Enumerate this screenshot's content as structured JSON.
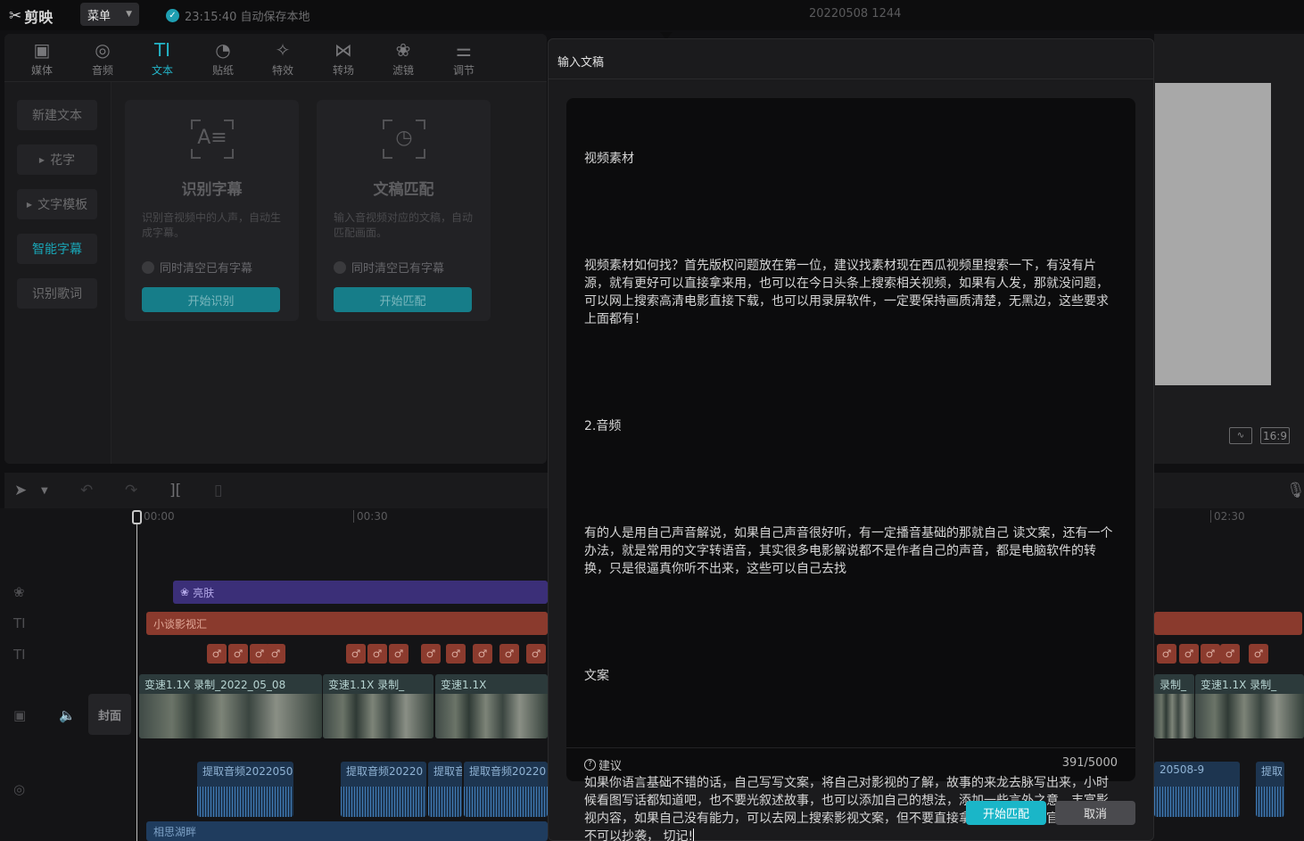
{
  "topbar": {
    "app_name": "剪映",
    "menu_label": "菜单",
    "autosave_text": "23:15:40 自动保存本地",
    "project_name": "20220508 1244"
  },
  "toolbar": {
    "tabs": [
      {
        "label": "媒体",
        "icon": "media-icon"
      },
      {
        "label": "音频",
        "icon": "audio-icon"
      },
      {
        "label": "文本",
        "icon": "text-icon",
        "active": true
      },
      {
        "label": "贴纸",
        "icon": "sticker-icon"
      },
      {
        "label": "特效",
        "icon": "effects-icon"
      },
      {
        "label": "转场",
        "icon": "transition-icon"
      },
      {
        "label": "滤镜",
        "icon": "filter-icon"
      },
      {
        "label": "调节",
        "icon": "adjust-icon"
      }
    ]
  },
  "side_menu": {
    "items": [
      "新建文本",
      "花字",
      "文字模板",
      "智能字幕",
      "识别歌词"
    ],
    "active": "智能字幕"
  },
  "cards": [
    {
      "glyph": "A≡",
      "title": "识别字幕",
      "desc": "识别音视频中的人声，自动生成字幕。",
      "check_label": "同时清空已有字幕",
      "button": "开始识别"
    },
    {
      "glyph": "◷",
      "title": "文稿匹配",
      "desc": "输入音视频对应的文稿，自动匹配画面。",
      "check_label": "同时清空已有字幕",
      "button": "开始匹配"
    }
  ],
  "preview": {
    "ratio": "16:9"
  },
  "timeline": {
    "ruler": [
      "00:00",
      "00:30",
      "02:30"
    ],
    "cover_label": "封面",
    "effect_clip": "亮肤",
    "text_clip": "小谈影视汇",
    "video_clips": [
      "变速1.1X   录制_2022_05_08",
      "变速1.1X   录制_",
      "变速1.1X",
      "录制_",
      "变速1.1X   录制_"
    ],
    "audio_clips": [
      "提取音频2022050",
      "提取音频20220",
      "提取音",
      "提取音频20220",
      "20508-9",
      "提取"
    ],
    "music_clip": "相思湖畔"
  },
  "modal": {
    "title": "输入文稿",
    "paragraphs": [
      "视频素材",
      "视频素材如何找？首先版权问题放在第一位，建议找素材现在西瓜视频里搜索一下，有没有片源，就有更好可以直接拿来用，也可以在今日头条上搜索相关视频，如果有人发，那就没问题，可以网上搜索高清电影直接下载，也可以用录屏软件，一定要保持画质清楚，无黑边，这些要求上面都有！",
      "2.音频",
      "有的人是用自己声音解说，如果自己声音很好听，有一定播音基础的那就自己 读文案，还有一个办法，就是常用的文字转语音，其实很多电影解说都不是作者自己的声音，都是电脑软件的转换，只是很逼真你听不出来，这些可以自己去找",
      "文案",
      "如果你语言基础不错的话，自己写写文案，将自己对影视的了解，故事的来龙去脉写出来，小时候看图写话都知道吧，也不要光叙述故事，也可以添加自己的想法，添加一些言外之意，丰富影视内容，如果自己没有能力，可以去网上搜索影视文案，但不要直接拿来用，头条号官方规定，不可以抄袭， 切记!"
    ],
    "suggest_label": "建议",
    "counter": "391/5000",
    "confirm": "开始匹配",
    "cancel": "取消"
  }
}
